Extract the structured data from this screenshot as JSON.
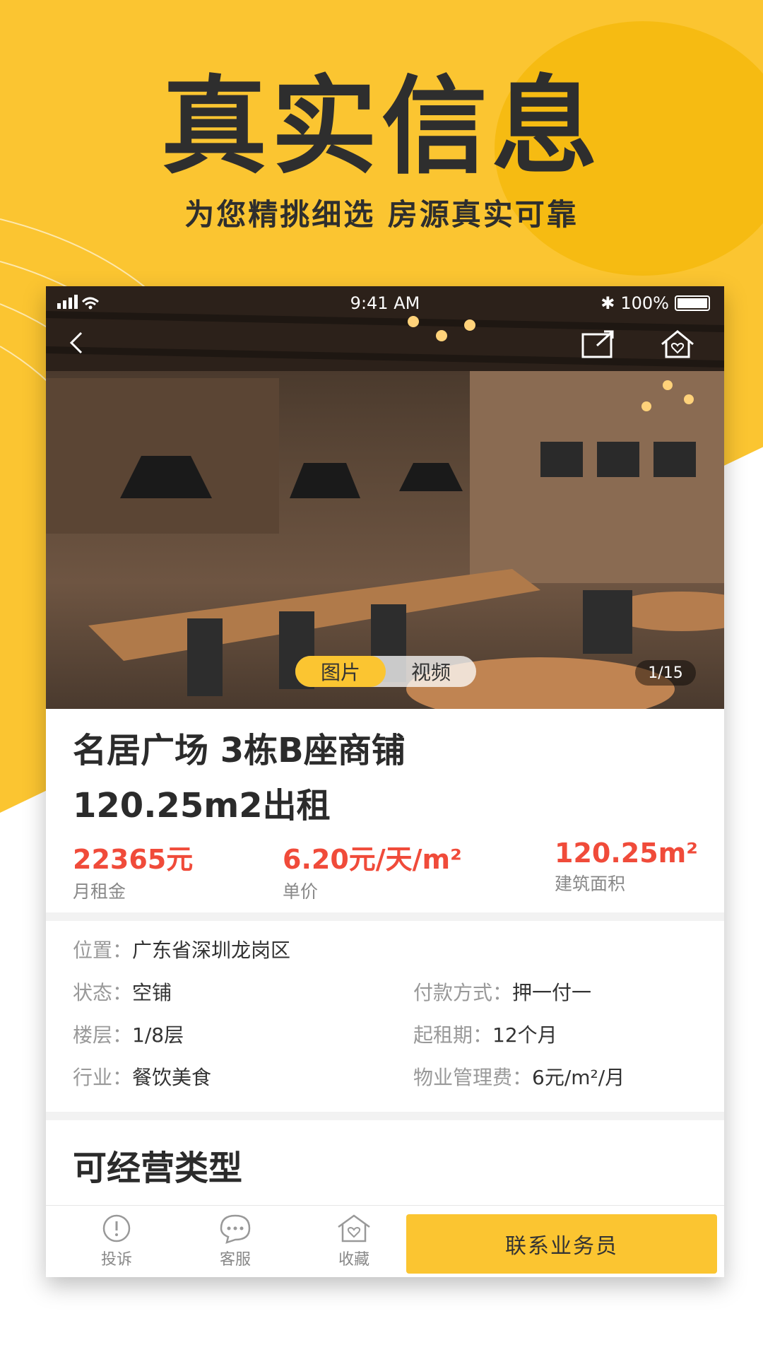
{
  "promo": {
    "headline": "真实信息",
    "subheadline": "为您精挑细选  房源真实可靠"
  },
  "status_bar": {
    "time": "9:41 AM",
    "battery": "100%"
  },
  "gallery": {
    "tabs": [
      {
        "label": "图片",
        "active": true
      },
      {
        "label": "视频",
        "active": false
      }
    ],
    "counter": "1/15"
  },
  "listing": {
    "title_line1": "名居广场 3栋B座商铺",
    "title_line2": "120.25m2出租",
    "stats": [
      {
        "value": "22365元",
        "label": "月租金"
      },
      {
        "value": "6.20元/天/m²",
        "label": "单价"
      },
      {
        "value": "120.25m²",
        "label": "建筑面积"
      }
    ]
  },
  "details": {
    "location": {
      "key": "位置：",
      "value": "广东省深圳龙岗区"
    },
    "status": {
      "key": "状态：",
      "value": "空铺"
    },
    "payment": {
      "key": "付款方式：",
      "value": "押一付一"
    },
    "floor": {
      "key": "楼层：",
      "value": "1/8层"
    },
    "lease_start": {
      "key": "起租期：",
      "value": "12个月"
    },
    "industry": {
      "key": "行业：",
      "value": "餐饮美食"
    },
    "property_fee": {
      "key": "物业管理费：",
      "value": "6元/m²/月"
    }
  },
  "types_section": {
    "title": "可经营类型"
  },
  "bottom_bar": {
    "complain": "投诉",
    "service": "客服",
    "favorite": "收藏",
    "contact": "联系业务员"
  },
  "colors": {
    "brand_yellow": "#fbc531",
    "price_red": "#f04b3a"
  }
}
